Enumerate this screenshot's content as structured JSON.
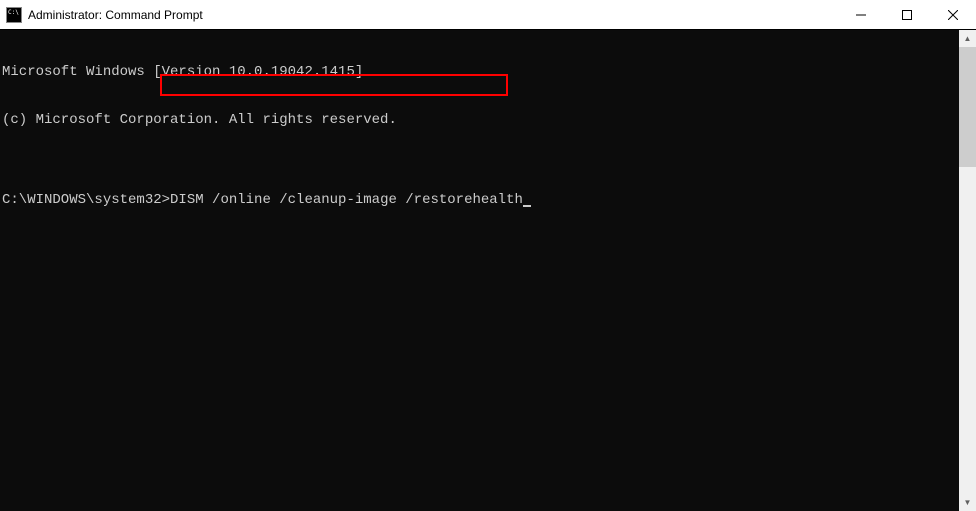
{
  "window": {
    "title": "Administrator: Command Prompt"
  },
  "terminal": {
    "line1": "Microsoft Windows [Version 10.0.19042.1415]",
    "line2": "(c) Microsoft Corporation. All rights reserved.",
    "blank": "",
    "prompt": "C:\\WINDOWS\\system32>",
    "command": "DISM /online /cleanup-image /restorehealth"
  }
}
